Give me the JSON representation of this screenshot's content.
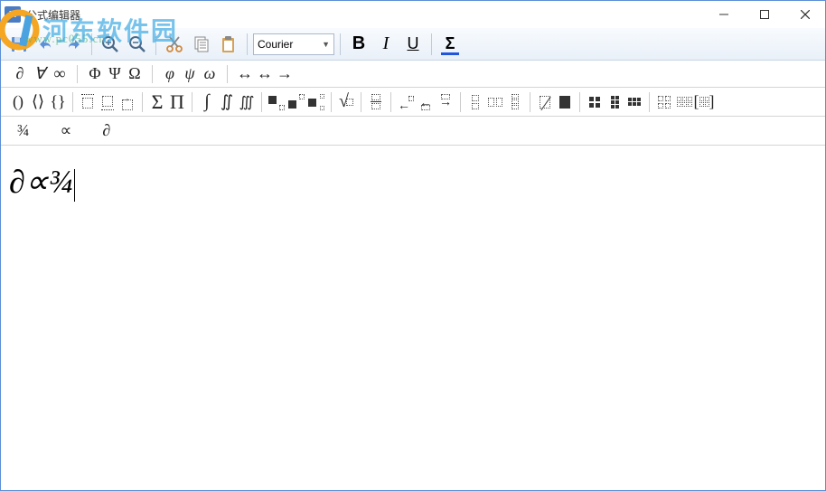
{
  "window": {
    "title": "公式编辑器",
    "app_icon_text": "M"
  },
  "watermark": {
    "main": "河东软件园",
    "sub": "www.pc055.cn"
  },
  "toolbar1": {
    "font_name": "Courier",
    "bold": "B",
    "italic": "I",
    "underline": "U",
    "color": "Σ"
  },
  "symbol_row": {
    "group1": [
      "∂",
      "∀",
      "∞"
    ],
    "group2": [
      "Φ",
      "Ψ",
      "Ω"
    ],
    "group3": [
      "φ",
      "ψ",
      "ω"
    ],
    "group4": [
      "↔",
      "↔",
      "→"
    ]
  },
  "template_row": {
    "brackets": [
      "()",
      "⟨⟩",
      "{}"
    ],
    "big_ops": [
      "Σ",
      "Π"
    ],
    "integrals": [
      "∫",
      "∬",
      "∭"
    ],
    "root": "√"
  },
  "recent_row": [
    "¾",
    "∝",
    "∂"
  ],
  "editor": {
    "content": "∂∝¾"
  }
}
